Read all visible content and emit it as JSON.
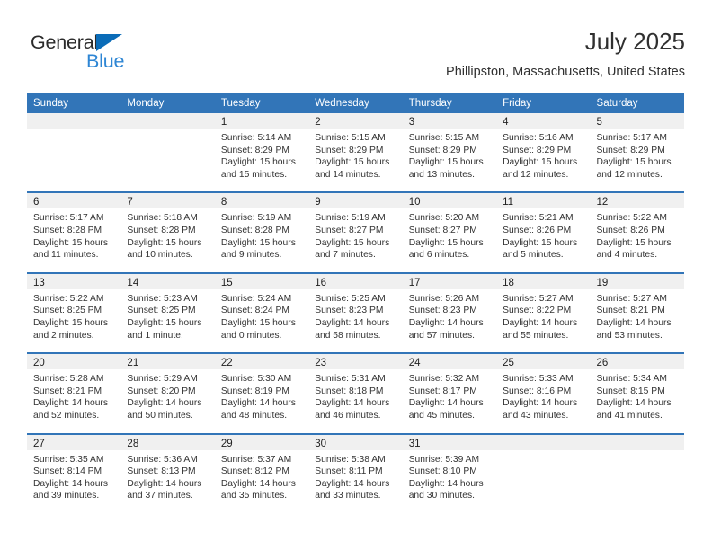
{
  "logo": {
    "primary_text": "General",
    "secondary_text": "Blue",
    "primary_color": "#2b2b2b",
    "secondary_color": "#2e86d4",
    "triangle_color": "#0a6cb8"
  },
  "header": {
    "title": "July 2025",
    "subtitle": "Phillipston, Massachusetts, United States"
  },
  "theme": {
    "header_blue": "#3275b8",
    "day_band_gray": "#f0f0f0",
    "text_color": "#333333"
  },
  "calendar": {
    "weekday_headers": [
      "Sunday",
      "Monday",
      "Tuesday",
      "Wednesday",
      "Thursday",
      "Friday",
      "Saturday"
    ],
    "weeks": [
      [
        {
          "day": "",
          "sunrise": "",
          "sunset": "",
          "daylight_line1": "",
          "daylight_line2": ""
        },
        {
          "day": "",
          "sunrise": "",
          "sunset": "",
          "daylight_line1": "",
          "daylight_line2": ""
        },
        {
          "day": "1",
          "sunrise": "Sunrise: 5:14 AM",
          "sunset": "Sunset: 8:29 PM",
          "daylight_line1": "Daylight: 15 hours",
          "daylight_line2": "and 15 minutes."
        },
        {
          "day": "2",
          "sunrise": "Sunrise: 5:15 AM",
          "sunset": "Sunset: 8:29 PM",
          "daylight_line1": "Daylight: 15 hours",
          "daylight_line2": "and 14 minutes."
        },
        {
          "day": "3",
          "sunrise": "Sunrise: 5:15 AM",
          "sunset": "Sunset: 8:29 PM",
          "daylight_line1": "Daylight: 15 hours",
          "daylight_line2": "and 13 minutes."
        },
        {
          "day": "4",
          "sunrise": "Sunrise: 5:16 AM",
          "sunset": "Sunset: 8:29 PM",
          "daylight_line1": "Daylight: 15 hours",
          "daylight_line2": "and 12 minutes."
        },
        {
          "day": "5",
          "sunrise": "Sunrise: 5:17 AM",
          "sunset": "Sunset: 8:29 PM",
          "daylight_line1": "Daylight: 15 hours",
          "daylight_line2": "and 12 minutes."
        }
      ],
      [
        {
          "day": "6",
          "sunrise": "Sunrise: 5:17 AM",
          "sunset": "Sunset: 8:28 PM",
          "daylight_line1": "Daylight: 15 hours",
          "daylight_line2": "and 11 minutes."
        },
        {
          "day": "7",
          "sunrise": "Sunrise: 5:18 AM",
          "sunset": "Sunset: 8:28 PM",
          "daylight_line1": "Daylight: 15 hours",
          "daylight_line2": "and 10 minutes."
        },
        {
          "day": "8",
          "sunrise": "Sunrise: 5:19 AM",
          "sunset": "Sunset: 8:28 PM",
          "daylight_line1": "Daylight: 15 hours",
          "daylight_line2": "and 9 minutes."
        },
        {
          "day": "9",
          "sunrise": "Sunrise: 5:19 AM",
          "sunset": "Sunset: 8:27 PM",
          "daylight_line1": "Daylight: 15 hours",
          "daylight_line2": "and 7 minutes."
        },
        {
          "day": "10",
          "sunrise": "Sunrise: 5:20 AM",
          "sunset": "Sunset: 8:27 PM",
          "daylight_line1": "Daylight: 15 hours",
          "daylight_line2": "and 6 minutes."
        },
        {
          "day": "11",
          "sunrise": "Sunrise: 5:21 AM",
          "sunset": "Sunset: 8:26 PM",
          "daylight_line1": "Daylight: 15 hours",
          "daylight_line2": "and 5 minutes."
        },
        {
          "day": "12",
          "sunrise": "Sunrise: 5:22 AM",
          "sunset": "Sunset: 8:26 PM",
          "daylight_line1": "Daylight: 15 hours",
          "daylight_line2": "and 4 minutes."
        }
      ],
      [
        {
          "day": "13",
          "sunrise": "Sunrise: 5:22 AM",
          "sunset": "Sunset: 8:25 PM",
          "daylight_line1": "Daylight: 15 hours",
          "daylight_line2": "and 2 minutes."
        },
        {
          "day": "14",
          "sunrise": "Sunrise: 5:23 AM",
          "sunset": "Sunset: 8:25 PM",
          "daylight_line1": "Daylight: 15 hours",
          "daylight_line2": "and 1 minute."
        },
        {
          "day": "15",
          "sunrise": "Sunrise: 5:24 AM",
          "sunset": "Sunset: 8:24 PM",
          "daylight_line1": "Daylight: 15 hours",
          "daylight_line2": "and 0 minutes."
        },
        {
          "day": "16",
          "sunrise": "Sunrise: 5:25 AM",
          "sunset": "Sunset: 8:23 PM",
          "daylight_line1": "Daylight: 14 hours",
          "daylight_line2": "and 58 minutes."
        },
        {
          "day": "17",
          "sunrise": "Sunrise: 5:26 AM",
          "sunset": "Sunset: 8:23 PM",
          "daylight_line1": "Daylight: 14 hours",
          "daylight_line2": "and 57 minutes."
        },
        {
          "day": "18",
          "sunrise": "Sunrise: 5:27 AM",
          "sunset": "Sunset: 8:22 PM",
          "daylight_line1": "Daylight: 14 hours",
          "daylight_line2": "and 55 minutes."
        },
        {
          "day": "19",
          "sunrise": "Sunrise: 5:27 AM",
          "sunset": "Sunset: 8:21 PM",
          "daylight_line1": "Daylight: 14 hours",
          "daylight_line2": "and 53 minutes."
        }
      ],
      [
        {
          "day": "20",
          "sunrise": "Sunrise: 5:28 AM",
          "sunset": "Sunset: 8:21 PM",
          "daylight_line1": "Daylight: 14 hours",
          "daylight_line2": "and 52 minutes."
        },
        {
          "day": "21",
          "sunrise": "Sunrise: 5:29 AM",
          "sunset": "Sunset: 8:20 PM",
          "daylight_line1": "Daylight: 14 hours",
          "daylight_line2": "and 50 minutes."
        },
        {
          "day": "22",
          "sunrise": "Sunrise: 5:30 AM",
          "sunset": "Sunset: 8:19 PM",
          "daylight_line1": "Daylight: 14 hours",
          "daylight_line2": "and 48 minutes."
        },
        {
          "day": "23",
          "sunrise": "Sunrise: 5:31 AM",
          "sunset": "Sunset: 8:18 PM",
          "daylight_line1": "Daylight: 14 hours",
          "daylight_line2": "and 46 minutes."
        },
        {
          "day": "24",
          "sunrise": "Sunrise: 5:32 AM",
          "sunset": "Sunset: 8:17 PM",
          "daylight_line1": "Daylight: 14 hours",
          "daylight_line2": "and 45 minutes."
        },
        {
          "day": "25",
          "sunrise": "Sunrise: 5:33 AM",
          "sunset": "Sunset: 8:16 PM",
          "daylight_line1": "Daylight: 14 hours",
          "daylight_line2": "and 43 minutes."
        },
        {
          "day": "26",
          "sunrise": "Sunrise: 5:34 AM",
          "sunset": "Sunset: 8:15 PM",
          "daylight_line1": "Daylight: 14 hours",
          "daylight_line2": "and 41 minutes."
        }
      ],
      [
        {
          "day": "27",
          "sunrise": "Sunrise: 5:35 AM",
          "sunset": "Sunset: 8:14 PM",
          "daylight_line1": "Daylight: 14 hours",
          "daylight_line2": "and 39 minutes."
        },
        {
          "day": "28",
          "sunrise": "Sunrise: 5:36 AM",
          "sunset": "Sunset: 8:13 PM",
          "daylight_line1": "Daylight: 14 hours",
          "daylight_line2": "and 37 minutes."
        },
        {
          "day": "29",
          "sunrise": "Sunrise: 5:37 AM",
          "sunset": "Sunset: 8:12 PM",
          "daylight_line1": "Daylight: 14 hours",
          "daylight_line2": "and 35 minutes."
        },
        {
          "day": "30",
          "sunrise": "Sunrise: 5:38 AM",
          "sunset": "Sunset: 8:11 PM",
          "daylight_line1": "Daylight: 14 hours",
          "daylight_line2": "and 33 minutes."
        },
        {
          "day": "31",
          "sunrise": "Sunrise: 5:39 AM",
          "sunset": "Sunset: 8:10 PM",
          "daylight_line1": "Daylight: 14 hours",
          "daylight_line2": "and 30 minutes."
        },
        {
          "day": "",
          "sunrise": "",
          "sunset": "",
          "daylight_line1": "",
          "daylight_line2": ""
        },
        {
          "day": "",
          "sunrise": "",
          "sunset": "",
          "daylight_line1": "",
          "daylight_line2": ""
        }
      ]
    ]
  }
}
